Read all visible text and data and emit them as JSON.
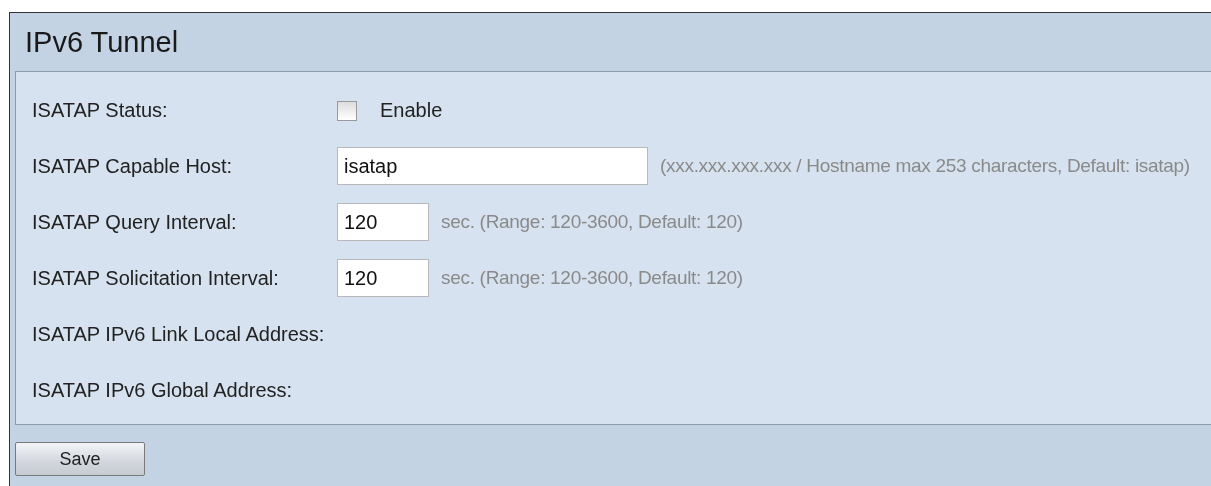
{
  "panel": {
    "title": "IPv6 Tunnel"
  },
  "rows": [
    {
      "kind": "checkbox",
      "label": "ISATAP Status:",
      "checked": false,
      "option": "Enable"
    },
    {
      "kind": "host_field",
      "label": "ISATAP Capable Host:",
      "value": "isatap",
      "hint": "(xxx.xxx.xxx.xxx / Hostname max 253 characters, Default: isatap)"
    },
    {
      "kind": "interval_field",
      "label": "ISATAP Query Interval:",
      "value": "120",
      "hint": "sec. (Range: 120-3600, Default: 120)"
    },
    {
      "kind": "interval_field",
      "label": "ISATAP Solicitation Interval:",
      "value": "120",
      "hint": "sec. (Range: 120-3600, Default: 120)"
    },
    {
      "kind": "info",
      "label": "ISATAP IPv6 Link Local Address:"
    },
    {
      "kind": "info",
      "label": "ISATAP IPv6 Global Address:"
    }
  ],
  "buttons": [
    "Save"
  ]
}
